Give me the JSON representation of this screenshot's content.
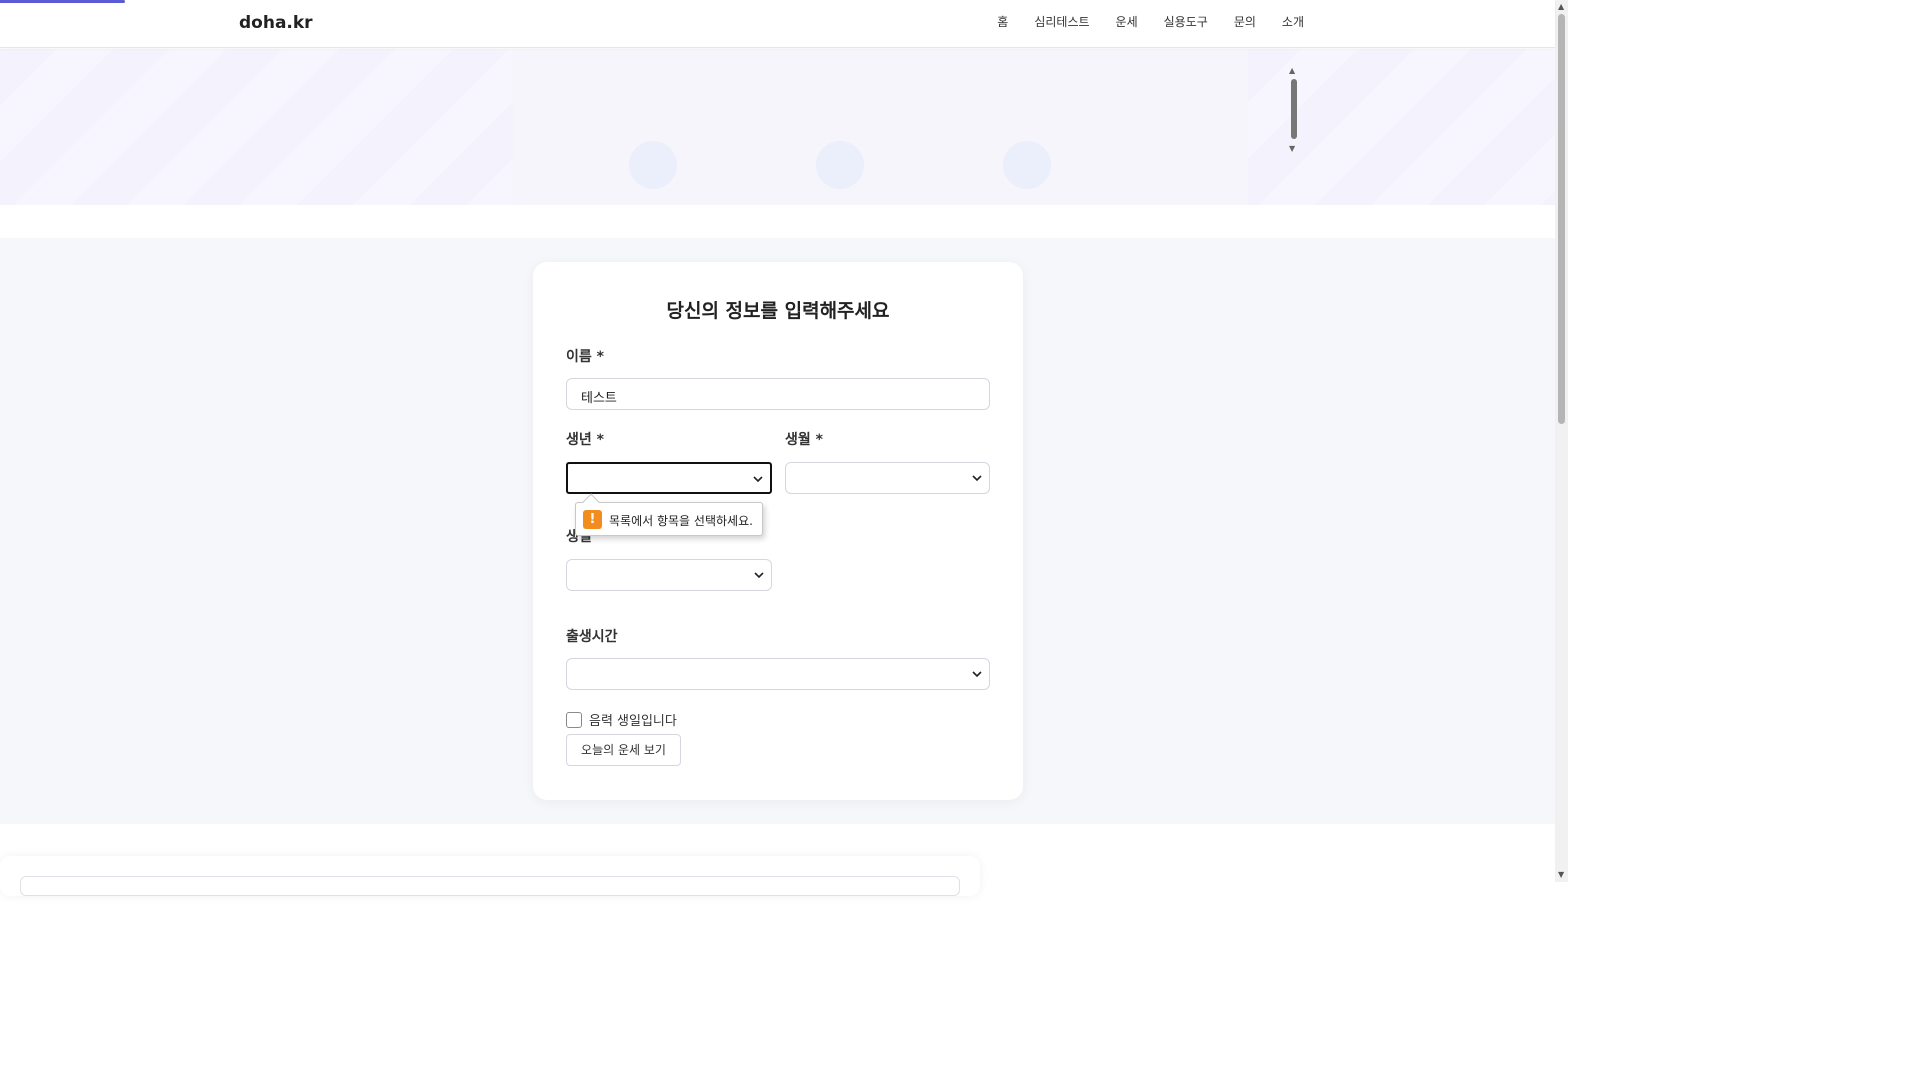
{
  "header": {
    "logo": "doha.kr",
    "nav": [
      "홈",
      "심리테스트",
      "운세",
      "실용도구",
      "문의",
      "소개"
    ]
  },
  "form": {
    "title": "당신의 정보를 입력해주세요",
    "name_label": "이름 *",
    "name_value": "테스트",
    "year_label": "생년 *",
    "month_label": "생월 *",
    "day_label": "생일",
    "time_label": "출생시간",
    "lunar_label": "음력 생일입니다",
    "submit_label": "오늘의 운세 보기"
  },
  "validation": {
    "message": "목록에서 항목을 선택하세요.",
    "icon": "warning-icon"
  },
  "colors": {
    "accent": "#5b5bd6",
    "warning": "#f28c1f"
  }
}
